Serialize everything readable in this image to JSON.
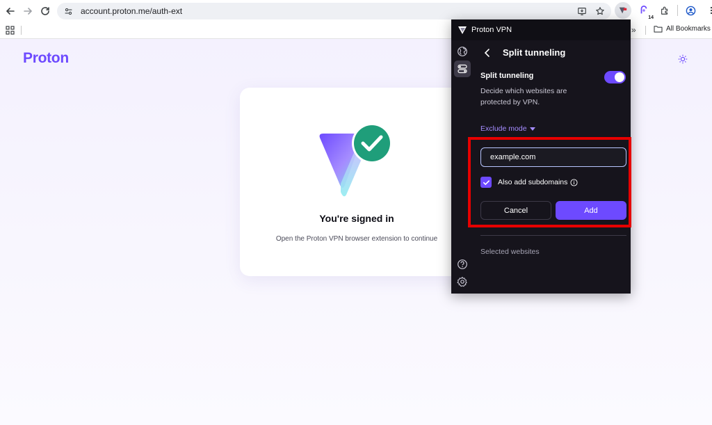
{
  "browser": {
    "url": "account.proton.me/auth-ext",
    "extension_badge": "14",
    "bookmarks_more": "»",
    "all_bookmarks": "All Bookmarks"
  },
  "page": {
    "logo": "Proton",
    "card": {
      "title": "You're signed in",
      "subtitle": "Open the Proton VPN browser extension to continue"
    }
  },
  "popup": {
    "app_name": "Proton VPN",
    "panel_title": "Split tunneling",
    "setting_label": "Split tunneling",
    "setting_enabled": true,
    "setting_description": "Decide which websites are protected by VPN.",
    "mode_label": "Exclude mode",
    "domain_value": "example.com",
    "subdomains_label": "Also add subdomains",
    "subdomains_checked": true,
    "cancel_label": "Cancel",
    "add_label": "Add",
    "selected_label": "Selected websites"
  },
  "colors": {
    "brand": "#6d4aff",
    "popup_bg": "#16141c",
    "highlight": "#e60000"
  }
}
